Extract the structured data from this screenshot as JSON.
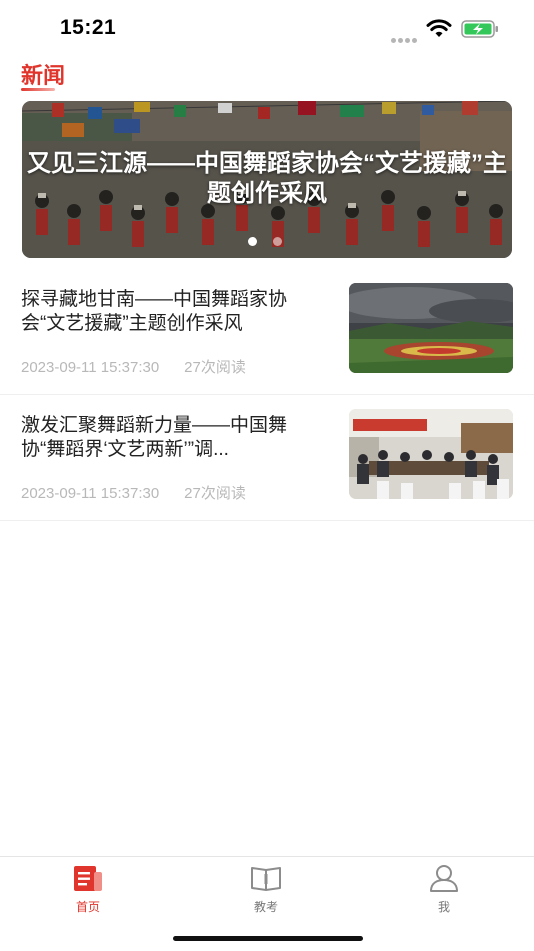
{
  "status_bar": {
    "time": "15:21",
    "battery_icon": "battery-charging-icon",
    "wifi_icon": "wifi-icon"
  },
  "section": {
    "title": "新闻"
  },
  "banner": {
    "title": "又见三江源——中国舞蹈家协会“文艺援藏”主题创作采风",
    "slide_count": 2,
    "active_slide": 1
  },
  "news": [
    {
      "title": "探寻藏地甘南——中国舞蹈家协会“文艺援藏”主题创作采风",
      "date": "2023-09-11 15:37:30",
      "reads": "27次阅读"
    },
    {
      "title": "激发汇聚舞蹈新力量——中国舞协“舞蹈界‘文艺两新’”调...",
      "date": "2023-09-11 15:37:30",
      "reads": "27次阅读"
    }
  ],
  "tabs": [
    {
      "label": "首页",
      "icon": "news-document-icon",
      "active": true
    },
    {
      "label": "教考",
      "icon": "book-icon",
      "active": false
    },
    {
      "label": "我",
      "icon": "user-icon",
      "active": false
    }
  ],
  "colors": {
    "accent": "#e0352c",
    "meta_text": "#b8b8b8",
    "tab_inactive": "#777777"
  }
}
